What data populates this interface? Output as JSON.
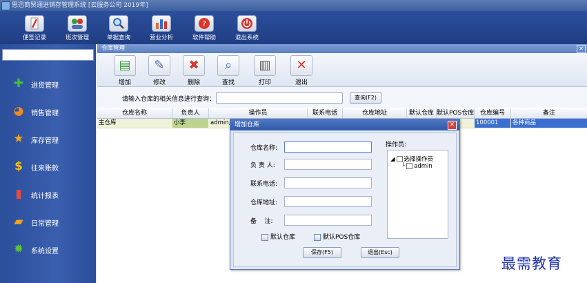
{
  "window": {
    "title": "思迅商贸通进销存管理系统 [云服务公司 2019年]"
  },
  "main_toolbar": [
    {
      "label": "便签记录",
      "icon": "note-icon",
      "color": "#d9342b"
    },
    {
      "label": "班次管理",
      "icon": "people-icon",
      "color": "#3a9b3a"
    },
    {
      "label": "单据查询",
      "icon": "magnifier-icon",
      "color": "#2d6fd0"
    },
    {
      "label": "营业分析",
      "icon": "bar-chart-icon",
      "color": "#e0712a"
    },
    {
      "label": "软件帮助",
      "icon": "help-icon",
      "color": "#d9342b"
    },
    {
      "label": "退出系统",
      "icon": "power-icon",
      "color": "#d9342b"
    }
  ],
  "sidebar": {
    "items": [
      {
        "label": "进货管理",
        "icon": "plus-icon",
        "glyph": "✚",
        "color": "#3fbf3f"
      },
      {
        "label": "销售管理",
        "icon": "pie-icon",
        "glyph": "◕",
        "color": "#f28a1a"
      },
      {
        "label": "库存管理",
        "icon": "star-icon",
        "glyph": "★",
        "color": "#f2a51a"
      },
      {
        "label": "往来账款",
        "icon": "dollar-icon",
        "glyph": "$",
        "color": "#f2c21a"
      },
      {
        "label": "统计报表",
        "icon": "bar-chart-icon",
        "glyph": "▮",
        "color": "#e94a3b"
      },
      {
        "label": "日常管理",
        "icon": "folder-icon",
        "glyph": "▰",
        "color": "#f2a51a"
      },
      {
        "label": "系统设置",
        "icon": "gear-icon",
        "glyph": "✹",
        "color": "#5ec23f"
      }
    ]
  },
  "tab": {
    "title": "仓库管理",
    "close_glyph": "✕"
  },
  "toolbar": [
    {
      "label": "增加",
      "icon": "add-doc-icon",
      "glyph": "▤",
      "color": "#3a9b3a"
    },
    {
      "label": "修改",
      "icon": "edit-doc-icon",
      "glyph": "✎",
      "color": "#4f6fb5"
    },
    {
      "label": "删除",
      "icon": "delete-icon",
      "glyph": "✖",
      "color": "#d9342b"
    },
    {
      "label": "查找",
      "icon": "search-icon",
      "glyph": "⌕",
      "color": "#2d6fd0"
    },
    {
      "label": "打印",
      "icon": "printer-icon",
      "glyph": "▥",
      "color": "#555555"
    },
    {
      "label": "退出",
      "icon": "exit-icon",
      "glyph": "✕",
      "color": "#d9342b"
    }
  ],
  "search": {
    "label": "请输入仓库的相关信息进行查询：",
    "value": "",
    "button": "查询(F2)"
  },
  "table": {
    "columns": [
      "仓库名称",
      "负责人",
      "操作员",
      "联系电话",
      "仓库地址",
      "默认仓库",
      "默认POS仓库",
      "仓库编号",
      "备注"
    ],
    "rows": [
      {
        "name": "主仓库",
        "manager": "小李",
        "operator": "admin,",
        "phone": "",
        "address": "",
        "default": "",
        "default_pos": "",
        "code": "100001",
        "note": "各种商品"
      }
    ]
  },
  "dialog": {
    "title": "增加仓库",
    "close_glyph": "✕",
    "fields": [
      {
        "label": "仓库名称:",
        "value": ""
      },
      {
        "label": "负 责 人:",
        "value": ""
      },
      {
        "label": "联系电话:",
        "value": ""
      },
      {
        "label": "仓库地址:",
        "value": ""
      },
      {
        "label": "备    注:",
        "value": ""
      }
    ],
    "operator_label": "操作员:",
    "tree_root": "选择操作员",
    "tree_child": "admin",
    "checkbox_default": "默认仓库",
    "checkbox_default_pos": "默认POS仓库",
    "save_button": "保存(F5)",
    "exit_button": "退出(Esc)"
  },
  "watermark": "最需教育"
}
